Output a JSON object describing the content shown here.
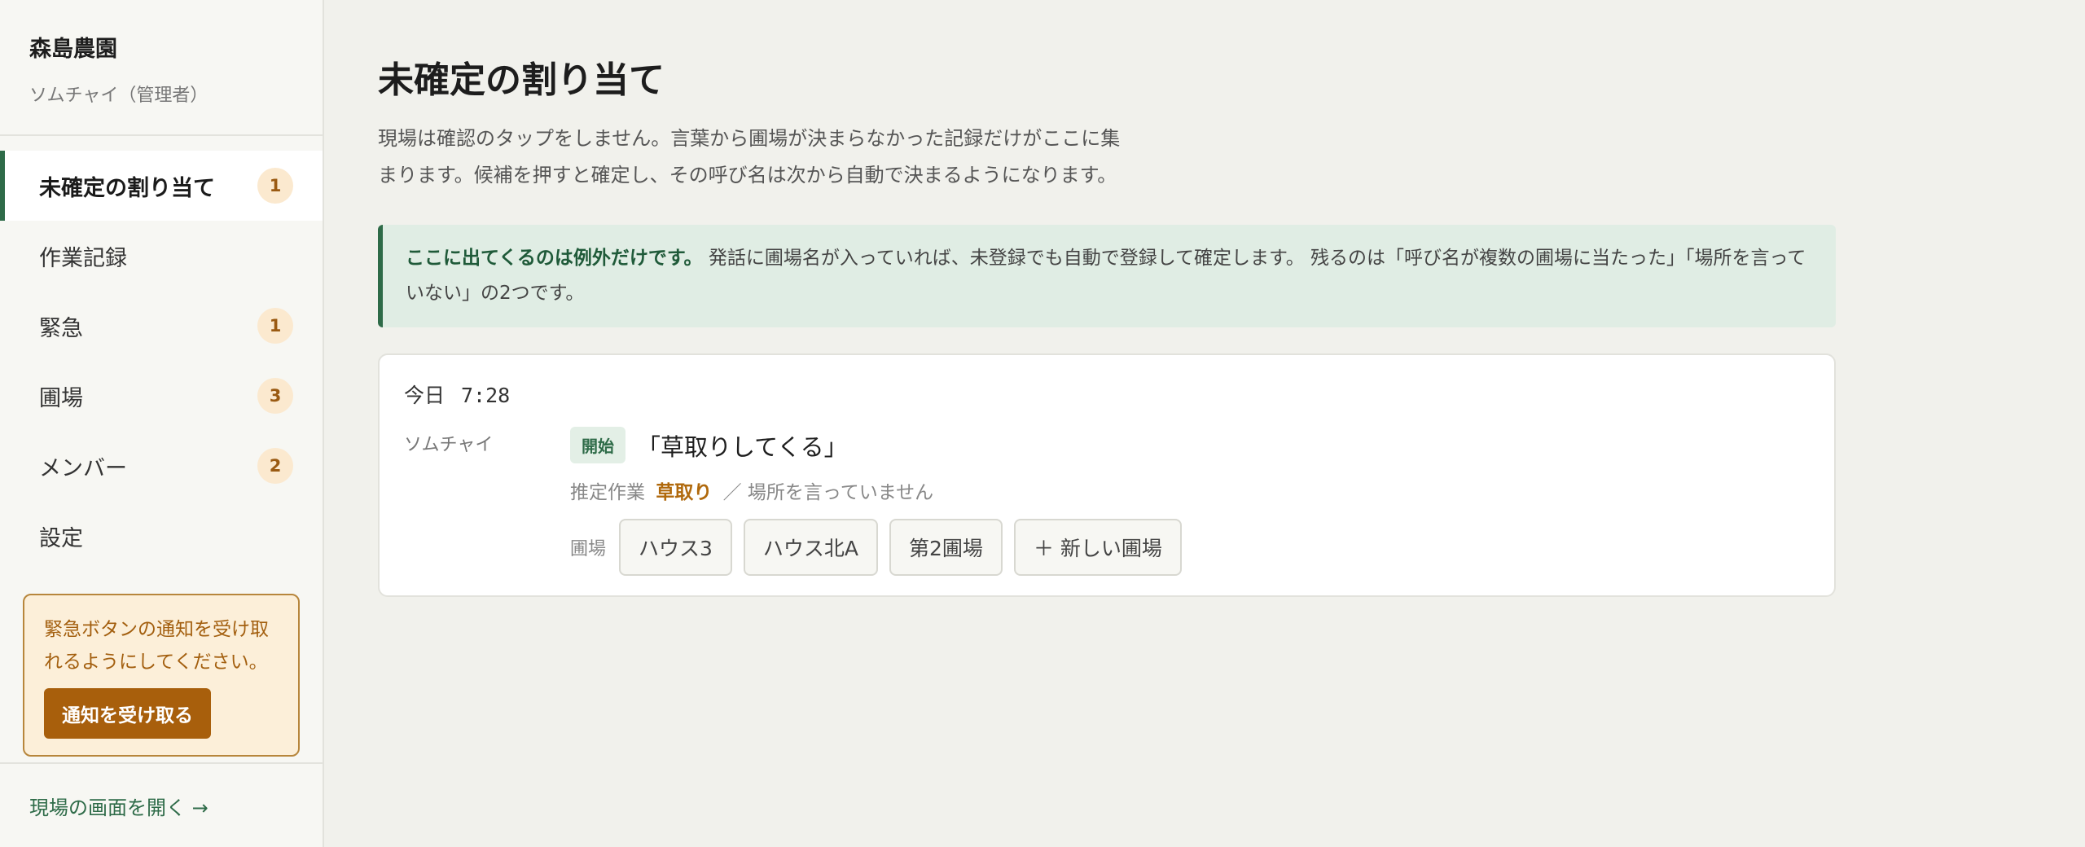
{
  "sidebar": {
    "brand": "森島農園",
    "user": "ソムチャイ（管理者）",
    "items": [
      {
        "label": "未確定の割り当て",
        "badge": "1"
      },
      {
        "label": "作業記録",
        "badge": ""
      },
      {
        "label": "緊急",
        "badge": "1"
      },
      {
        "label": "圃場",
        "badge": "3"
      },
      {
        "label": "メンバー",
        "badge": "2"
      },
      {
        "label": "設定",
        "badge": ""
      }
    ],
    "notice": {
      "text": "緊急ボタンの通知を受け取れるようにしてください。",
      "button": "通知を受け取る"
    },
    "footer_link": "現場の画面を開く →"
  },
  "main": {
    "title": "未確定の割り当て",
    "description": "現場は確認のタップをしません。言葉から圃場が決まらなかった記録だけがここに集まります。候補を押すと確定し、その呼び名は次から自動で決まるようになります。",
    "info_bold": "ここに出てくるのは例外だけです。",
    "info_text": "発話に圃場名が入っていれば、未登録でも自動で登録して確定します。 残るのは「呼び名が複数の圃場に当たった」「場所を言っていない」の2つです。",
    "card": {
      "day": "今日",
      "time": "7:28",
      "worker": "ソムチャイ",
      "tag": "開始",
      "utterance": "「草取りしてくる」",
      "guess_label": "推定作業",
      "guess_task": "草取り",
      "guess_note": "／ 場所を言っていません",
      "choices_label": "圃場",
      "choices": [
        "ハウス3",
        "ハウス北A",
        "第2圃場",
        "＋ 新しい圃場"
      ]
    }
  },
  "colors": {
    "accent": "#2e6b48",
    "warning": "#a85f0c",
    "badge_bg": "#fbe9cf"
  }
}
